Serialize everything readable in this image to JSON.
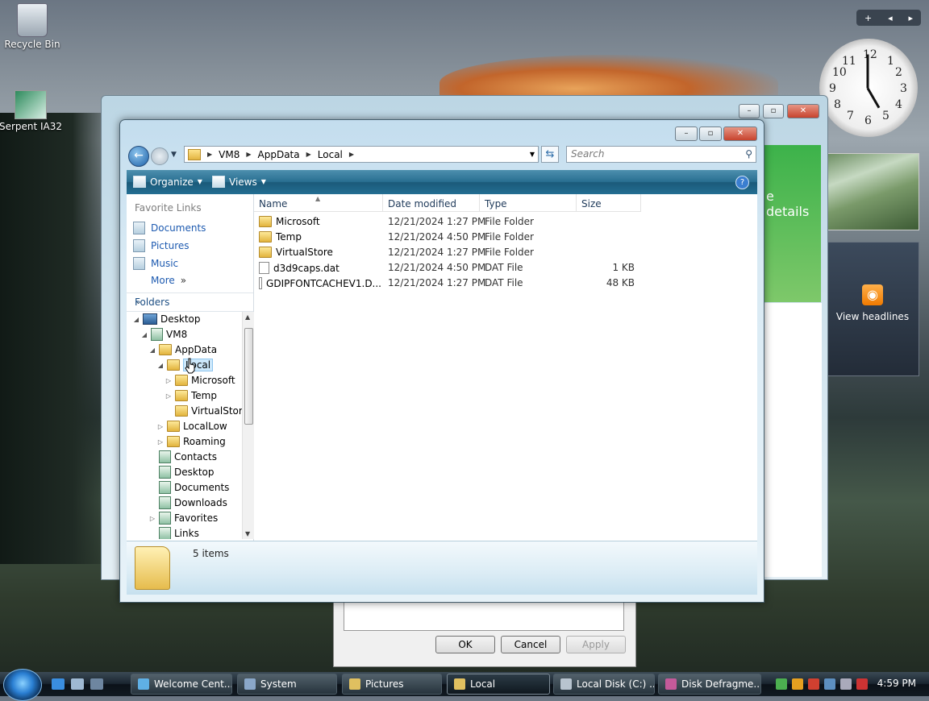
{
  "desktop": {
    "icons": [
      {
        "label": "Recycle Bin"
      },
      {
        "label": "Serpent IA32"
      }
    ]
  },
  "gadgets": {
    "clock_numbers": [
      "12",
      "1",
      "2",
      "3",
      "4",
      "5",
      "6",
      "7",
      "8",
      "9",
      "10",
      "11"
    ],
    "rss_label": "View headlines"
  },
  "background": {
    "welcome_text": "e details",
    "dialog_buttons": {
      "ok": "OK",
      "cancel": "Cancel",
      "apply": "Apply"
    }
  },
  "explorer": {
    "breadcrumb": [
      "VM8",
      "AppData",
      "Local"
    ],
    "search_placeholder": "Search",
    "toolbar": {
      "organize": "Organize",
      "views": "Views",
      "help": "?"
    },
    "favorite_links_header": "Favorite Links",
    "favorites": [
      "Documents",
      "Pictures",
      "Music",
      "More"
    ],
    "folders_header": "Folders",
    "tree": [
      {
        "label": "Desktop"
      },
      {
        "label": "VM8"
      },
      {
        "label": "AppData"
      },
      {
        "label": "Local"
      },
      {
        "label": "Microsoft"
      },
      {
        "label": "Temp"
      },
      {
        "label": "VirtualStore"
      },
      {
        "label": "LocalLow"
      },
      {
        "label": "Roaming"
      },
      {
        "label": "Contacts"
      },
      {
        "label": "Desktop"
      },
      {
        "label": "Documents"
      },
      {
        "label": "Downloads"
      },
      {
        "label": "Favorites"
      },
      {
        "label": "Links"
      }
    ],
    "columns": [
      "Name",
      "Date modified",
      "Type",
      "Size"
    ],
    "files": [
      {
        "name": "Microsoft",
        "date": "12/21/2024 1:27 PM",
        "type": "File Folder",
        "size": ""
      },
      {
        "name": "Temp",
        "date": "12/21/2024 4:50 PM",
        "type": "File Folder",
        "size": ""
      },
      {
        "name": "VirtualStore",
        "date": "12/21/2024 1:27 PM",
        "type": "File Folder",
        "size": ""
      },
      {
        "name": "d3d9caps.dat",
        "date": "12/21/2024 4:50 PM",
        "type": "DAT File",
        "size": "1 KB"
      },
      {
        "name": "GDIPFONTCACHEV1.D...",
        "date": "12/21/2024 1:27 PM",
        "type": "DAT File",
        "size": "48 KB"
      }
    ],
    "item_count": "5 items"
  },
  "taskbar": {
    "tasks": [
      "Welcome Cent...",
      "System",
      "Pictures",
      "Local",
      "Local Disk (C:) ...",
      "Disk Defragme..."
    ],
    "time": "4:59 PM"
  },
  "colors": {
    "accent": "#1d5ab0",
    "toolbar": "#296f91",
    "selection": "#cde8fb"
  }
}
